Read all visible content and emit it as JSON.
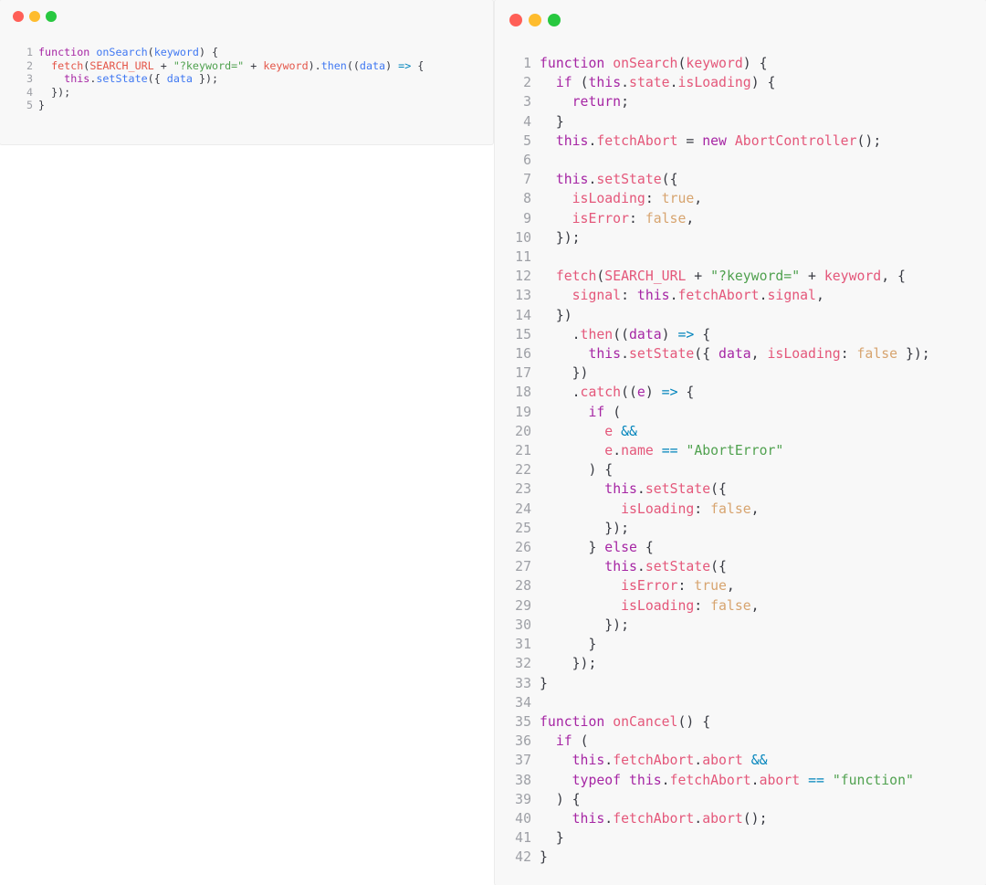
{
  "window_controls": {
    "close_color": "#ff5f57",
    "minimize_color": "#febc2e",
    "zoom_color": "#28c840"
  },
  "theme": {
    "background": "#f8f8f8",
    "line_number": "#9ea0a6"
  },
  "snippet_simple": {
    "lines": [
      {
        "n": "1",
        "tokens": [
          [
            "function",
            "kw"
          ],
          [
            " ",
            "plain"
          ],
          [
            "onSearch",
            "fn"
          ],
          [
            "(",
            "plain"
          ],
          [
            "keyword",
            "fn"
          ],
          [
            ") {",
            "plain"
          ]
        ]
      },
      {
        "n": "2",
        "tokens": [
          [
            "  ",
            "plain"
          ],
          [
            "fetch",
            "var"
          ],
          [
            "(",
            "plain"
          ],
          [
            "SEARCH_URL",
            "var"
          ],
          [
            " + ",
            "plain"
          ],
          [
            "\"?keyword=\"",
            "str"
          ],
          [
            " + ",
            "plain"
          ],
          [
            "keyword",
            "var"
          ],
          [
            ").",
            "plain"
          ],
          [
            "then",
            "fn"
          ],
          [
            "((",
            "plain"
          ],
          [
            "data",
            "fn"
          ],
          [
            ") ",
            "plain"
          ],
          [
            "=>",
            "op"
          ],
          [
            " {",
            "plain"
          ]
        ]
      },
      {
        "n": "3",
        "tokens": [
          [
            "    ",
            "plain"
          ],
          [
            "this",
            "kw"
          ],
          [
            ".",
            "plain"
          ],
          [
            "setState",
            "fn"
          ],
          [
            "({ ",
            "plain"
          ],
          [
            "data",
            "fn"
          ],
          [
            " });",
            "plain"
          ]
        ]
      },
      {
        "n": "4",
        "tokens": [
          [
            "  });",
            "plain"
          ]
        ]
      },
      {
        "n": "5",
        "tokens": [
          [
            "}",
            "plain"
          ]
        ]
      }
    ]
  },
  "snippet_full": {
    "lines": [
      {
        "n": "1",
        "tokens": [
          [
            "function",
            "kw"
          ],
          [
            " ",
            "plain"
          ],
          [
            "onSearch",
            "pink"
          ],
          [
            "(",
            "plain"
          ],
          [
            "keyword",
            "pink"
          ],
          [
            ") {",
            "plain"
          ]
        ]
      },
      {
        "n": "2",
        "tokens": [
          [
            "  ",
            "plain"
          ],
          [
            "if",
            "kw"
          ],
          [
            " (",
            "plain"
          ],
          [
            "this",
            "kw"
          ],
          [
            ".",
            "plain"
          ],
          [
            "state",
            "pink"
          ],
          [
            ".",
            "plain"
          ],
          [
            "isLoading",
            "pink"
          ],
          [
            ") {",
            "plain"
          ]
        ]
      },
      {
        "n": "3",
        "tokens": [
          [
            "    ",
            "plain"
          ],
          [
            "return",
            "kw"
          ],
          [
            ";",
            "plain"
          ]
        ]
      },
      {
        "n": "4",
        "tokens": [
          [
            "  }",
            "plain"
          ]
        ]
      },
      {
        "n": "5",
        "tokens": [
          [
            "  ",
            "plain"
          ],
          [
            "this",
            "kw"
          ],
          [
            ".",
            "plain"
          ],
          [
            "fetchAbort",
            "pink"
          ],
          [
            " = ",
            "plain"
          ],
          [
            "new",
            "kw"
          ],
          [
            " ",
            "plain"
          ],
          [
            "AbortController",
            "pink"
          ],
          [
            "();",
            "plain"
          ]
        ]
      },
      {
        "n": "6",
        "tokens": []
      },
      {
        "n": "7",
        "tokens": [
          [
            "  ",
            "plain"
          ],
          [
            "this",
            "kw"
          ],
          [
            ".",
            "plain"
          ],
          [
            "setState",
            "pink"
          ],
          [
            "({",
            "plain"
          ]
        ]
      },
      {
        "n": "8",
        "tokens": [
          [
            "    ",
            "plain"
          ],
          [
            "isLoading",
            "pink"
          ],
          [
            ": ",
            "plain"
          ],
          [
            "true",
            "bool"
          ],
          [
            ",",
            "plain"
          ]
        ]
      },
      {
        "n": "9",
        "tokens": [
          [
            "    ",
            "plain"
          ],
          [
            "isError",
            "pink"
          ],
          [
            ": ",
            "plain"
          ],
          [
            "false",
            "bool"
          ],
          [
            ",",
            "plain"
          ]
        ]
      },
      {
        "n": "10",
        "tokens": [
          [
            "  });",
            "plain"
          ]
        ]
      },
      {
        "n": "11",
        "tokens": []
      },
      {
        "n": "12",
        "tokens": [
          [
            "  ",
            "plain"
          ],
          [
            "fetch",
            "pink"
          ],
          [
            "(",
            "plain"
          ],
          [
            "SEARCH_URL",
            "pink"
          ],
          [
            " + ",
            "plain"
          ],
          [
            "\"?keyword=\"",
            "str"
          ],
          [
            " + ",
            "plain"
          ],
          [
            "keyword",
            "pink"
          ],
          [
            ", {",
            "plain"
          ]
        ]
      },
      {
        "n": "13",
        "tokens": [
          [
            "    ",
            "plain"
          ],
          [
            "signal",
            "pink"
          ],
          [
            ": ",
            "plain"
          ],
          [
            "this",
            "kw"
          ],
          [
            ".",
            "plain"
          ],
          [
            "fetchAbort",
            "pink"
          ],
          [
            ".",
            "plain"
          ],
          [
            "signal",
            "pink"
          ],
          [
            ",",
            "plain"
          ]
        ]
      },
      {
        "n": "14",
        "tokens": [
          [
            "  })",
            "plain"
          ]
        ]
      },
      {
        "n": "15",
        "tokens": [
          [
            "    .",
            "plain"
          ],
          [
            "then",
            "pink"
          ],
          [
            "((",
            "plain"
          ],
          [
            "data",
            "kw"
          ],
          [
            ") ",
            "plain"
          ],
          [
            "=>",
            "op"
          ],
          [
            " {",
            "plain"
          ]
        ]
      },
      {
        "n": "16",
        "tokens": [
          [
            "      ",
            "plain"
          ],
          [
            "this",
            "kw"
          ],
          [
            ".",
            "plain"
          ],
          [
            "setState",
            "pink"
          ],
          [
            "({ ",
            "plain"
          ],
          [
            "data",
            "kw"
          ],
          [
            ", ",
            "plain"
          ],
          [
            "isLoading",
            "pink"
          ],
          [
            ": ",
            "plain"
          ],
          [
            "false",
            "bool"
          ],
          [
            " });",
            "plain"
          ]
        ]
      },
      {
        "n": "17",
        "tokens": [
          [
            "    })",
            "plain"
          ]
        ]
      },
      {
        "n": "18",
        "tokens": [
          [
            "    .",
            "plain"
          ],
          [
            "catch",
            "pink"
          ],
          [
            "((",
            "plain"
          ],
          [
            "e",
            "kw"
          ],
          [
            ") ",
            "plain"
          ],
          [
            "=>",
            "op"
          ],
          [
            " {",
            "plain"
          ]
        ]
      },
      {
        "n": "19",
        "tokens": [
          [
            "      ",
            "plain"
          ],
          [
            "if",
            "kw"
          ],
          [
            " (",
            "plain"
          ]
        ]
      },
      {
        "n": "20",
        "tokens": [
          [
            "        ",
            "plain"
          ],
          [
            "e",
            "pink"
          ],
          [
            " ",
            "plain"
          ],
          [
            "&&",
            "op"
          ]
        ]
      },
      {
        "n": "21",
        "tokens": [
          [
            "        ",
            "plain"
          ],
          [
            "e",
            "pink"
          ],
          [
            ".",
            "plain"
          ],
          [
            "name",
            "pink"
          ],
          [
            " ",
            "plain"
          ],
          [
            "==",
            "op"
          ],
          [
            " ",
            "plain"
          ],
          [
            "\"AbortError\"",
            "str"
          ]
        ]
      },
      {
        "n": "22",
        "tokens": [
          [
            "      ) {",
            "plain"
          ]
        ]
      },
      {
        "n": "23",
        "tokens": [
          [
            "        ",
            "plain"
          ],
          [
            "this",
            "kw"
          ],
          [
            ".",
            "plain"
          ],
          [
            "setState",
            "pink"
          ],
          [
            "({",
            "plain"
          ]
        ]
      },
      {
        "n": "24",
        "tokens": [
          [
            "          ",
            "plain"
          ],
          [
            "isLoading",
            "pink"
          ],
          [
            ": ",
            "plain"
          ],
          [
            "false",
            "bool"
          ],
          [
            ",",
            "plain"
          ]
        ]
      },
      {
        "n": "25",
        "tokens": [
          [
            "        });",
            "plain"
          ]
        ]
      },
      {
        "n": "26",
        "tokens": [
          [
            "      } ",
            "plain"
          ],
          [
            "else",
            "kw"
          ],
          [
            " {",
            "plain"
          ]
        ]
      },
      {
        "n": "27",
        "tokens": [
          [
            "        ",
            "plain"
          ],
          [
            "this",
            "kw"
          ],
          [
            ".",
            "plain"
          ],
          [
            "setState",
            "pink"
          ],
          [
            "({",
            "plain"
          ]
        ]
      },
      {
        "n": "28",
        "tokens": [
          [
            "          ",
            "plain"
          ],
          [
            "isError",
            "pink"
          ],
          [
            ": ",
            "plain"
          ],
          [
            "true",
            "bool"
          ],
          [
            ",",
            "plain"
          ]
        ]
      },
      {
        "n": "29",
        "tokens": [
          [
            "          ",
            "plain"
          ],
          [
            "isLoading",
            "pink"
          ],
          [
            ": ",
            "plain"
          ],
          [
            "false",
            "bool"
          ],
          [
            ",",
            "plain"
          ]
        ]
      },
      {
        "n": "30",
        "tokens": [
          [
            "        });",
            "plain"
          ]
        ]
      },
      {
        "n": "31",
        "tokens": [
          [
            "      }",
            "plain"
          ]
        ]
      },
      {
        "n": "32",
        "tokens": [
          [
            "    });",
            "plain"
          ]
        ]
      },
      {
        "n": "33",
        "tokens": [
          [
            "}",
            "plain"
          ]
        ]
      },
      {
        "n": "34",
        "tokens": []
      },
      {
        "n": "35",
        "tokens": [
          [
            "function",
            "kw"
          ],
          [
            " ",
            "plain"
          ],
          [
            "onCancel",
            "pink"
          ],
          [
            "() {",
            "plain"
          ]
        ]
      },
      {
        "n": "36",
        "tokens": [
          [
            "  ",
            "plain"
          ],
          [
            "if",
            "kw"
          ],
          [
            " (",
            "plain"
          ]
        ]
      },
      {
        "n": "37",
        "tokens": [
          [
            "    ",
            "plain"
          ],
          [
            "this",
            "kw"
          ],
          [
            ".",
            "plain"
          ],
          [
            "fetchAbort",
            "pink"
          ],
          [
            ".",
            "plain"
          ],
          [
            "abort",
            "pink"
          ],
          [
            " ",
            "plain"
          ],
          [
            "&&",
            "op"
          ]
        ]
      },
      {
        "n": "38",
        "tokens": [
          [
            "    ",
            "plain"
          ],
          [
            "typeof",
            "kw"
          ],
          [
            " ",
            "plain"
          ],
          [
            "this",
            "kw"
          ],
          [
            ".",
            "plain"
          ],
          [
            "fetchAbort",
            "pink"
          ],
          [
            ".",
            "plain"
          ],
          [
            "abort",
            "pink"
          ],
          [
            " ",
            "plain"
          ],
          [
            "==",
            "op"
          ],
          [
            " ",
            "plain"
          ],
          [
            "\"function\"",
            "str"
          ]
        ]
      },
      {
        "n": "39",
        "tokens": [
          [
            "  ) {",
            "plain"
          ]
        ]
      },
      {
        "n": "40",
        "tokens": [
          [
            "    ",
            "plain"
          ],
          [
            "this",
            "kw"
          ],
          [
            ".",
            "plain"
          ],
          [
            "fetchAbort",
            "pink"
          ],
          [
            ".",
            "plain"
          ],
          [
            "abort",
            "pink"
          ],
          [
            "();",
            "plain"
          ]
        ]
      },
      {
        "n": "41",
        "tokens": [
          [
            "  }",
            "plain"
          ]
        ]
      },
      {
        "n": "42",
        "tokens": [
          [
            "}",
            "plain"
          ]
        ]
      }
    ]
  }
}
